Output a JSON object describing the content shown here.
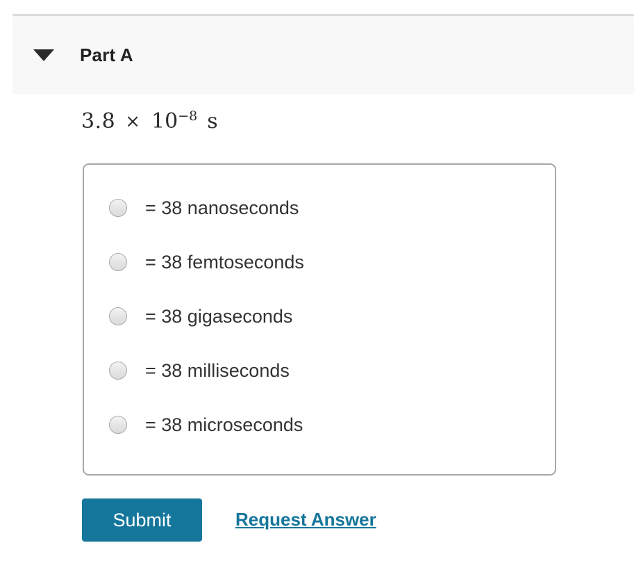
{
  "colors": {
    "accent": "#15769b",
    "header_band": "#f8f8f8",
    "rule": "#dcdcdc",
    "box_border": "#a8a8a8",
    "text": "#333333",
    "title_text": "#222222"
  },
  "header": {
    "caret_icon": "caret-down-icon",
    "title": "Part A"
  },
  "question": {
    "math": {
      "coefficient": "3.8",
      "operator": "×",
      "base": "10",
      "exponent": "−8",
      "unit": "s",
      "plain": "3.8 × 10−8 s"
    }
  },
  "answers": {
    "selected": null,
    "options": [
      {
        "id": "opt-nanoseconds",
        "label": "= 38 nanoseconds"
      },
      {
        "id": "opt-femtoseconds",
        "label": "= 38 femtoseconds"
      },
      {
        "id": "opt-gigaseconds",
        "label": "= 38 gigaseconds"
      },
      {
        "id": "opt-milliseconds",
        "label": "= 38 milliseconds"
      },
      {
        "id": "opt-microseconds",
        "label": "= 38 microseconds"
      }
    ]
  },
  "actions": {
    "submit_label": "Submit",
    "request_answer_label": "Request Answer"
  }
}
